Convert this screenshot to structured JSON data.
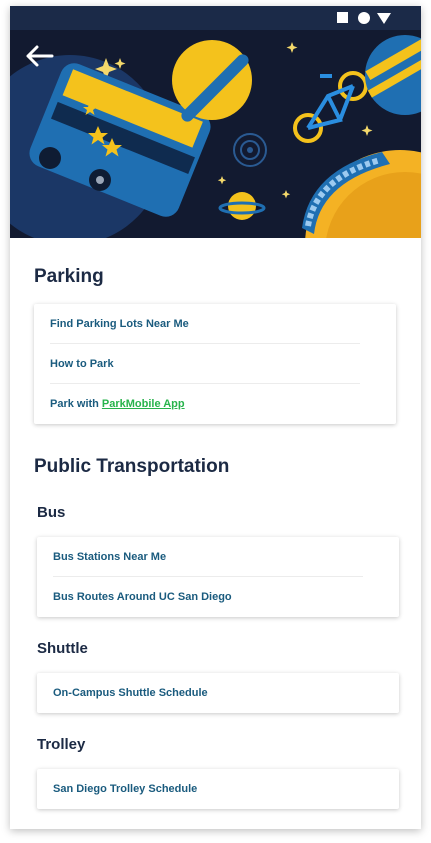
{
  "header": {
    "back_label": "Back"
  },
  "parking": {
    "title": "Parking",
    "items": [
      {
        "label": "Find Parking Lots Near Me"
      },
      {
        "label": "How to Park"
      },
      {
        "label_prefix": "Park with",
        "label_link": "ParkMobile App"
      }
    ]
  },
  "public_transportation": {
    "title": "Public Transportation",
    "bus": {
      "title": "Bus",
      "items": [
        {
          "label": "Bus Stations Near Me"
        },
        {
          "label": "Bus Routes Around UC San Diego"
        }
      ]
    },
    "shuttle": {
      "title": "Shuttle",
      "items": [
        {
          "label": "On-Campus Shuttle Schedule"
        }
      ]
    },
    "trolley": {
      "title": "Trolley",
      "items": [
        {
          "label": "San Diego Trolley Schedule"
        }
      ]
    }
  },
  "colors": {
    "status_bar": "#1b2a48",
    "heading": "#1c2a44",
    "link": "#1a5b7e",
    "link_green": "#27b34b",
    "hero_bg": "#121a30",
    "accent_yellow": "#f4c21c",
    "accent_blue": "#1f6fb2"
  }
}
